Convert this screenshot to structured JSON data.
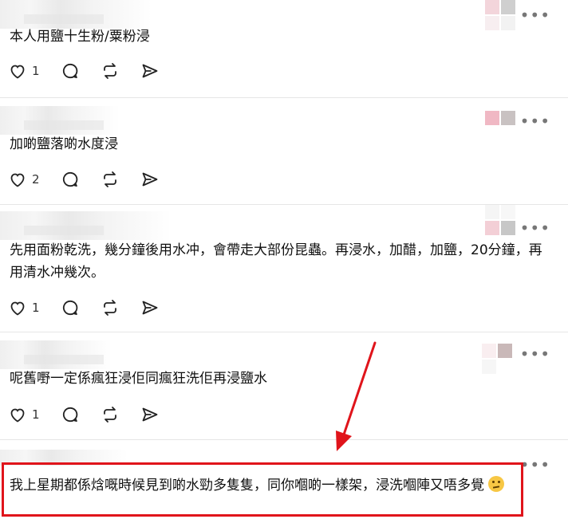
{
  "posts": [
    {
      "text": "本人用鹽十生粉/粟粉浸",
      "likes": "1"
    },
    {
      "text": "加啲鹽落啲水度浸",
      "likes": "2"
    },
    {
      "text": "先用面粉乾洗，幾分鐘後用水冲，會帶走大部份昆蟲。再浸水，加醋，加鹽，20分鐘，再用清水冲幾次。",
      "likes": "1"
    },
    {
      "text": "呢舊嘢一定係瘋狂浸佢同瘋狂洗佢再浸鹽水",
      "likes": "1"
    },
    {
      "text": "我上星期都係焓嘅時候見到啲水勁多隻隻，同你嗰啲一樣架，浸洗嗰陣又唔多覺"
    }
  ],
  "more_label": "•••",
  "colors": {
    "highlight": "#e0141b",
    "arrow": "#e0141b"
  },
  "icons": [
    "heart-icon",
    "comment-icon",
    "repost-icon",
    "share-icon",
    "more-icon",
    "thinking-emoji-icon"
  ]
}
